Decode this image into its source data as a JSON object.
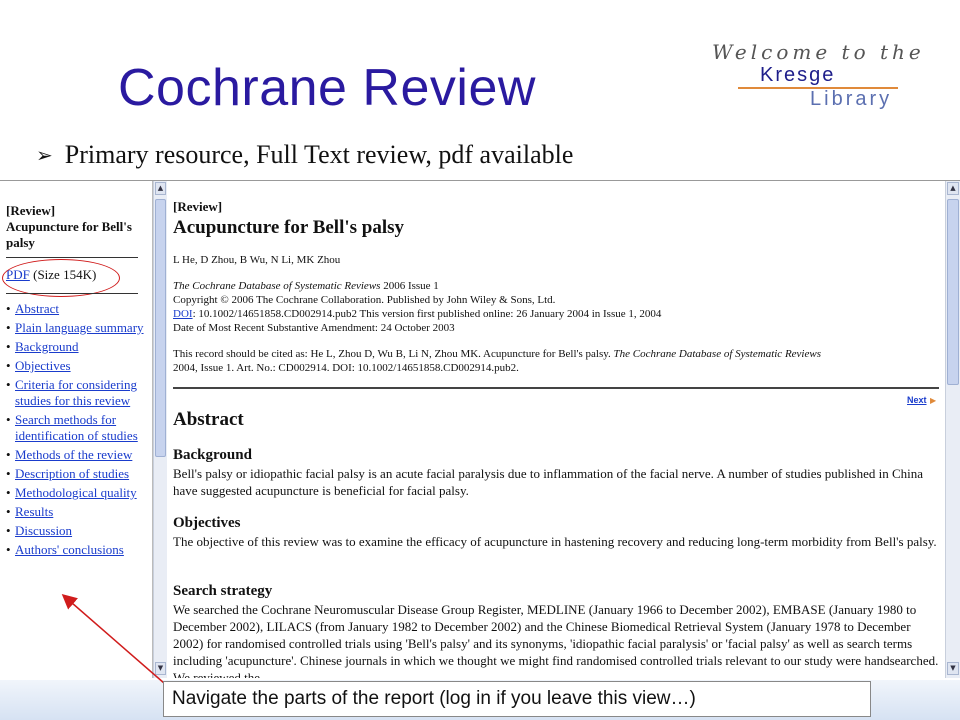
{
  "slide": {
    "title": "Cochrane Review",
    "bullet": "Primary resource, Full Text review, pdf available",
    "logo": {
      "welcome": "Welcome to the",
      "kresge": "Kresge",
      "library": "Library"
    }
  },
  "nav": {
    "heading": "[Review]\nAcupuncture for Bell's palsy",
    "pdf_link": "PDF",
    "pdf_size": " (Size 154K)",
    "items": [
      "Abstract",
      "Plain language summary",
      "Background",
      "Objectives",
      "Criteria for considering studies for this review",
      "Search methods for identification of studies",
      "Methods of the review",
      "Description of studies",
      "Methodological quality",
      "Results",
      "Discussion",
      "Authors' conclusions"
    ]
  },
  "review": {
    "label": "[Review]",
    "title": "Acupuncture for Bell's palsy",
    "authors": "L He, D Zhou, B Wu, N Li, MK Zhou",
    "journal": "The Cochrane Database of Systematic Reviews",
    "issue": " 2006 Issue 1",
    "copyright": "Copyright © 2006 The Cochrane Collaboration. Published by John Wiley & Sons, Ltd.",
    "doi_label": "DOI",
    "doi_text": ": 10.1002/14651858.CD002914.pub2   This version first published online: 26 January 2004 in Issue 1, 2004",
    "amendment": "Date of Most Recent Substantive Amendment: 24 October 2003",
    "cite_1": "This record should be cited as: He L, Zhou D, Wu B, Li N, Zhou MK. Acupuncture for Bell's palsy. ",
    "cite_journal": "The Cochrane Database of Systematic Reviews",
    "cite_2": "2004, Issue 1. Art. No.: CD002914. DOI: 10.1002/14651858.CD002914.pub2.",
    "next": "Next",
    "abstract_heading": "Abstract",
    "background_heading": "Background",
    "background_text": "Bell's palsy or idiopathic facial palsy is an acute facial paralysis due to inflammation of the facial nerve. A number of studies published in China have suggested acupuncture is beneficial for facial palsy.",
    "objectives_heading": "Objectives",
    "objectives_text": "The objective of this review was to examine the efficacy of acupuncture in hastening recovery and reducing long-term morbidity from Bell's palsy.",
    "search_heading": "Search strategy",
    "search_text": "We searched the Cochrane Neuromuscular Disease Group Register, MEDLINE (January 1966 to December 2002), EMBASE (January 1980 to December 2002), LILACS (from January 1982 to December 2002) and the Chinese Biomedical Retrieval System (January 1978 to December 2002) for randomised controlled trials using 'Bell's palsy' and its synonyms, 'idiopathic facial paralysis' or 'facial palsy' as well as search terms including 'acupuncture'. Chinese journals in which we thought we might find randomised controlled trials relevant to our study were handsearched. We reviewed the"
  },
  "callout": "Navigate the parts of the report (log in if you leave this view…)",
  "colors": {
    "title": "#2a1aa0",
    "link": "#1a3ccc",
    "annotation": "#d01c1c"
  }
}
